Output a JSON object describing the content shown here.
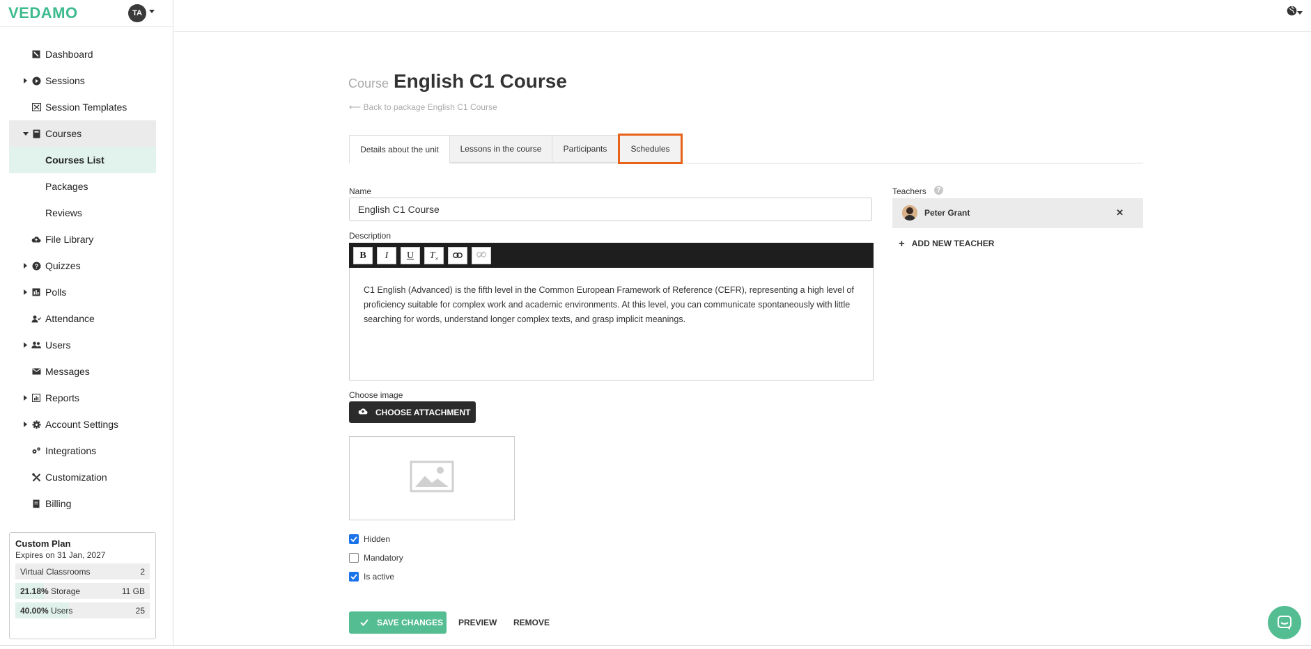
{
  "app": {
    "logo": "VEDAMO",
    "avatar_initials": "TA"
  },
  "sidebar": {
    "items": [
      {
        "label": "Dashboard",
        "icon": "dashboard-icon",
        "expandable": false
      },
      {
        "label": "Sessions",
        "icon": "play-circle-icon",
        "expandable": true
      },
      {
        "label": "Session Templates",
        "icon": "template-icon",
        "expandable": false
      },
      {
        "label": "Courses",
        "icon": "book-icon",
        "expandable": true,
        "open": true
      },
      {
        "label": "Courses List",
        "sub": true,
        "selected": true
      },
      {
        "label": "Packages",
        "sub": true
      },
      {
        "label": "Reviews",
        "sub": true
      },
      {
        "label": "File Library",
        "icon": "cloud-icon",
        "expandable": false
      },
      {
        "label": "Quizzes",
        "icon": "question-circle-icon",
        "expandable": true
      },
      {
        "label": "Polls",
        "icon": "poll-icon",
        "expandable": true
      },
      {
        "label": "Attendance",
        "icon": "user-check-icon",
        "expandable": false
      },
      {
        "label": "Users",
        "icon": "users-icon",
        "expandable": true
      },
      {
        "label": "Messages",
        "icon": "envelope-icon",
        "expandable": false
      },
      {
        "label": "Reports",
        "icon": "chart-icon",
        "expandable": true
      },
      {
        "label": "Account Settings",
        "icon": "gear-icon",
        "expandable": true
      },
      {
        "label": "Integrations",
        "icon": "cogs-icon",
        "expandable": false
      },
      {
        "label": "Customization",
        "icon": "tools-icon",
        "expandable": false
      },
      {
        "label": "Billing",
        "icon": "receipt-icon",
        "expandable": false
      }
    ]
  },
  "plan": {
    "title": "Custom Plan",
    "expires": "Expires on 31 Jan, 2027",
    "rows": [
      {
        "pct": "",
        "label": "Virtual Classrooms",
        "value": "2"
      },
      {
        "pct": "21.18%",
        "label": "Storage",
        "value": "11 GB"
      },
      {
        "pct": "40.00%",
        "label": "Users",
        "value": "25"
      }
    ]
  },
  "page": {
    "type_label": "Course",
    "title": "English C1 Course",
    "back_link": "⟵ Back to package English C1 Course"
  },
  "tabs": [
    {
      "label": "Details about the unit",
      "active": true
    },
    {
      "label": "Lessons in the course"
    },
    {
      "label": "Participants"
    },
    {
      "label": "Schedules",
      "highlighted": true
    }
  ],
  "form": {
    "name_label": "Name",
    "name_value": "English C1 Course",
    "description_label": "Description",
    "description_text": "C1 English (Advanced) is the fifth level in the Common European Framework of Reference (CEFR), representing a high level of proficiency suitable for complex work and academic environments. At this level, you can communicate spontaneously with little searching for words, understand longer complex texts, and grasp implicit meanings.",
    "toolbar": {
      "bold": "B",
      "italic": "I",
      "underline": "U",
      "clear": "T"
    },
    "image_label": "Choose image",
    "attach_label": "CHOOSE ATTACHMENT",
    "checkboxes": [
      {
        "label": "Hidden",
        "checked": true
      },
      {
        "label": "Mandatory",
        "checked": false
      },
      {
        "label": "Is active",
        "checked": true
      }
    ],
    "save_label": "SAVE CHANGES",
    "preview_label": "PREVIEW",
    "remove_label": "REMOVE"
  },
  "teachers": {
    "label": "Teachers",
    "list": [
      {
        "name": "Peter Grant"
      }
    ],
    "add_label": "ADD NEW TEACHER"
  },
  "colors": {
    "brand": "#3dbb8e",
    "save": "#55bd92",
    "highlight": "#e8621a",
    "checkbox": "#1a73e8"
  }
}
